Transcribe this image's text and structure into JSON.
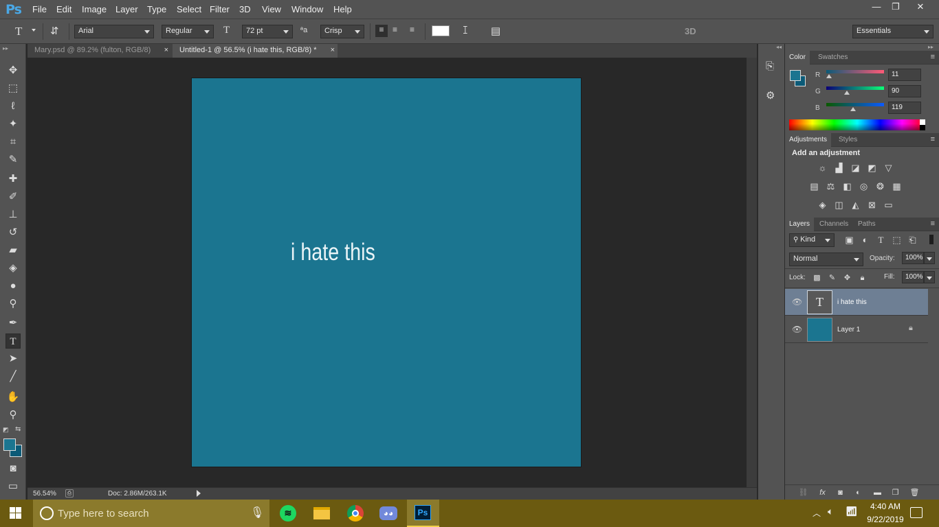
{
  "app": {
    "logo": "Ps"
  },
  "menu": [
    "File",
    "Edit",
    "Image",
    "Layer",
    "Type",
    "Select",
    "Filter",
    "3D",
    "View",
    "Window",
    "Help"
  ],
  "window_controls": {
    "minimize": "—",
    "restore": "❐",
    "close": "✕"
  },
  "options": {
    "font_family": "Arial",
    "font_style": "Regular",
    "font_size": "72 pt",
    "antialias": "Crisp",
    "mode_3d": "3D",
    "workspace": "Essentials",
    "text_color": "#ffffff"
  },
  "tabs": [
    {
      "label": "Mary.psd @ 89.2% (fulton, RGB/8)",
      "close": "×"
    },
    {
      "label": "Untitled-1 @ 56.5% (i hate this, RGB/8) *",
      "close": "×"
    }
  ],
  "canvas": {
    "text": "i hate this",
    "bg_color": "#1b7590"
  },
  "status": {
    "zoom": "56.54%",
    "doc": "Doc: 2.86M/263.1K"
  },
  "color_panel": {
    "tabs": [
      "Color",
      "Swatches"
    ],
    "foreground": "#0b5a77",
    "r_label": "R",
    "g_label": "G",
    "b_label": "B",
    "r": "11",
    "g": "90",
    "b": "119"
  },
  "adjustments_panel": {
    "tabs": [
      "Adjustments",
      "Styles"
    ],
    "heading": "Add an adjustment"
  },
  "layers_panel": {
    "tabs": [
      "Layers",
      "Channels",
      "Paths"
    ],
    "filter": "Kind",
    "blend_mode": "Normal",
    "opacity_label": "Opacity:",
    "opacity": "100%",
    "lock_label": "Lock:",
    "fill_label": "Fill:",
    "fill": "100%",
    "layers": [
      {
        "name": "i hate this",
        "type": "text",
        "thumb": "T"
      },
      {
        "name": "Layer 1",
        "type": "fill"
      }
    ]
  },
  "taskbar": {
    "search_placeholder": "Type here to search",
    "time": "4:40 AM",
    "date": "9/22/2019",
    "ps_label": "Ps"
  }
}
